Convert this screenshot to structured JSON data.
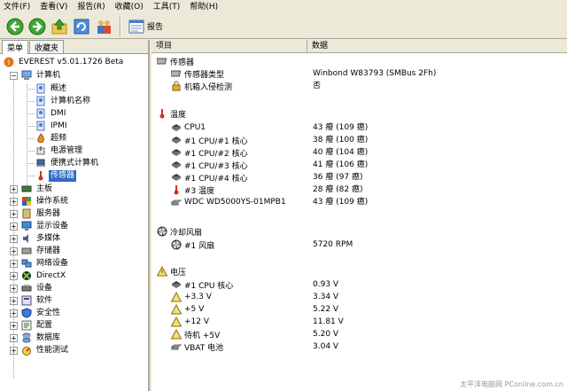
{
  "menu": [
    "文件(F)",
    "查看(V)",
    "报告(R)",
    "收藏(O)",
    "工具(T)",
    "帮助(H)"
  ],
  "toolbar": {
    "report_label": "报告"
  },
  "left_tabs": [
    "菜单",
    "收藏夹"
  ],
  "tree": {
    "root": "EVEREST v5.01.1726 Beta",
    "computer": "计算机",
    "computer_children": [
      "概述",
      "计算机名称",
      "DMI",
      "IPMI",
      "超频",
      "电源管理",
      "便携式计算机",
      "传感器"
    ],
    "top_items": [
      "主板",
      "操作系统",
      "服务器",
      "显示设备",
      "多媒体",
      "存储器",
      "网络设备",
      "DirectX",
      "设备",
      "软件",
      "安全性",
      "配置",
      "数据库",
      "性能测试"
    ]
  },
  "columns": {
    "item": "项目",
    "data": "数据"
  },
  "sections": {
    "sensor": {
      "title": "传感器",
      "rows": [
        {
          "label": "传感器类型",
          "value": "Winbond W83793  (SMBus 2Fh)"
        },
        {
          "label": "机箱入侵检测",
          "value": "否"
        }
      ]
    },
    "temperature": {
      "title": "温度",
      "rows": [
        {
          "label": "CPU1",
          "value": "43 癈  (109 癋)"
        },
        {
          "label": "#1 CPU/#1 核心",
          "value": "38 癈  (100 癋)"
        },
        {
          "label": "#1 CPU/#2 核心",
          "value": "40 癈  (104 癋)"
        },
        {
          "label": "#1 CPU/#3 核心",
          "value": "41 癈  (106 癋)"
        },
        {
          "label": "#1 CPU/#4 核心",
          "value": "36 癈  (97 癋)"
        },
        {
          "label": "#3 温度",
          "value": "28 癈  (82 癋)"
        },
        {
          "label": "WDC WD5000YS-01MPB1",
          "value": "43 癈  (109 癋)"
        }
      ]
    },
    "fans": {
      "title": "冷却风扇",
      "rows": [
        {
          "label": "#1 风扇",
          "value": "5720 RPM"
        }
      ]
    },
    "voltage": {
      "title": "电压",
      "rows": [
        {
          "label": "#1 CPU 核心",
          "value": "0.93 V"
        },
        {
          "label": "+3.3 V",
          "value": "3.34 V"
        },
        {
          "label": "+5 V",
          "value": "5.22 V"
        },
        {
          "label": "+12 V",
          "value": "11.81 V"
        },
        {
          "label": "待机 +5V",
          "value": "5.20 V"
        },
        {
          "label": "VBAT 电池",
          "value": "3.04 V"
        }
      ]
    }
  },
  "watermark": "太平洋电脑网 PConline.com.cn",
  "colors": {
    "selection": "#316ac5",
    "background": "#ece9d8"
  }
}
